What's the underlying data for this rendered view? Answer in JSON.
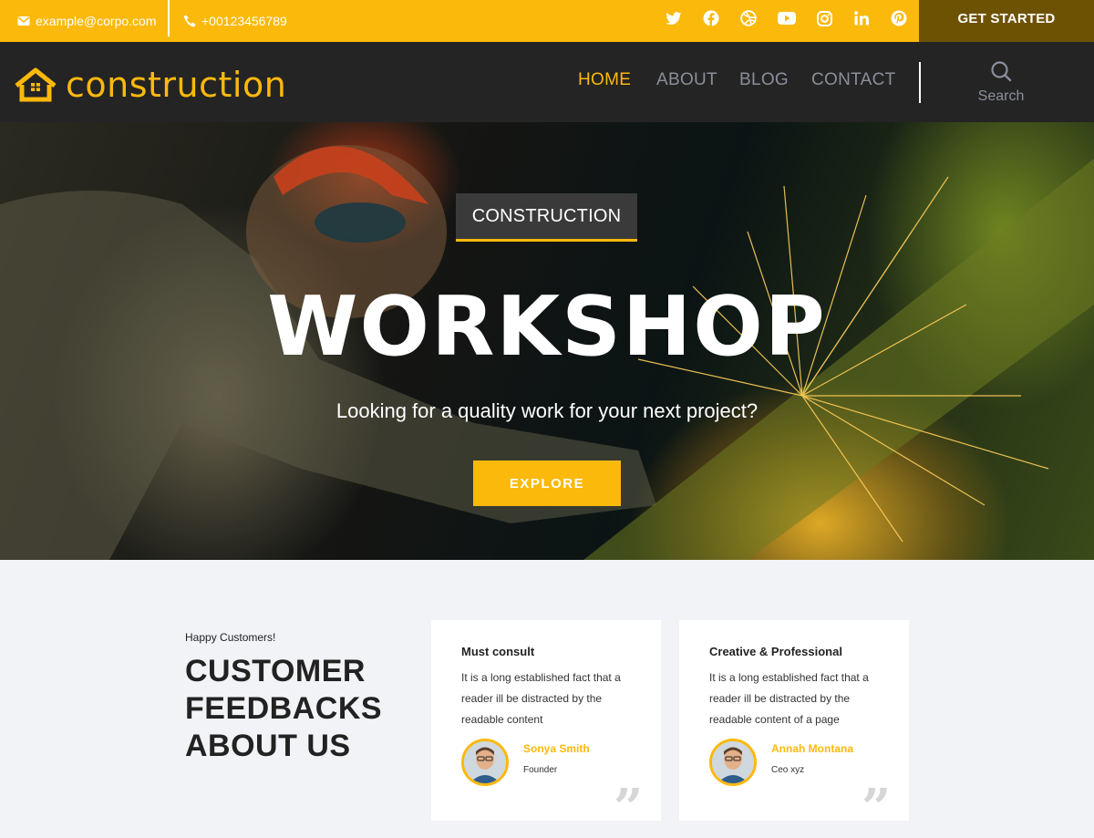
{
  "topbar": {
    "email": "example@corpo.com",
    "phone": "+00123456789",
    "cta_label": "GET STARTED",
    "socials": [
      "twitter-icon",
      "facebook-icon",
      "dribbble-icon",
      "youtube-icon",
      "instagram-icon",
      "linkedin-icon",
      "pinterest-icon"
    ],
    "colors": {
      "accent": "#fbb90b",
      "cta_bg": "#6e5203"
    }
  },
  "nav": {
    "logo_text": "construction",
    "items": [
      {
        "label": "HOME",
        "active": true
      },
      {
        "label": "ABOUT",
        "active": false
      },
      {
        "label": "BLOG",
        "active": false
      },
      {
        "label": "CONTACT",
        "active": false
      }
    ],
    "search_label": "Search"
  },
  "hero": {
    "tag": "CONSTRUCTION",
    "title": "WORKSHOP",
    "subtitle": "Looking for a quality work for your next project?",
    "button_label": "EXPLORE"
  },
  "feedback": {
    "kicker": "Happy Customers!",
    "title": "CUSTOMER FEEDBACKS ABOUT US",
    "cards": [
      {
        "heading": "Must consult",
        "text": "It is a long established fact that a reader ill be distracted by the readable content",
        "name": "Sonya Smith",
        "role": "Founder"
      },
      {
        "heading": "Creative & Professional",
        "text": "It is a long established fact that a reader ill be distracted by the readable content of a page",
        "name": "Annah Montana",
        "role": "Ceo xyz"
      }
    ]
  }
}
